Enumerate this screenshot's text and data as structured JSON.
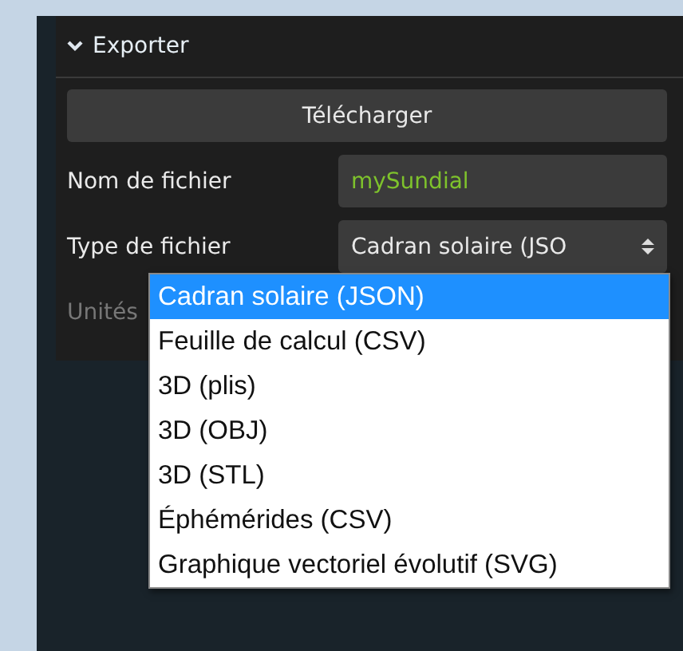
{
  "section": {
    "title": "Exporter",
    "expanded": true
  },
  "download_button": "Télécharger",
  "fields": [
    {
      "label": "Nom de fichier",
      "kind": "text",
      "value": "mySundial"
    },
    {
      "label": "Type de fichier",
      "kind": "select",
      "value": "Cadran solaire (JSO"
    },
    {
      "label": "Unités",
      "kind": "label"
    }
  ],
  "dropdown": {
    "options": [
      {
        "label": "Cadran solaire (JSON)",
        "selected": true
      },
      {
        "label": "Feuille de calcul (CSV)",
        "selected": false
      },
      {
        "label": "3D (plis)",
        "selected": false
      },
      {
        "label": "3D (OBJ)",
        "selected": false
      },
      {
        "label": "3D (STL)",
        "selected": false
      },
      {
        "label": "Éphémérides (CSV)",
        "selected": false
      },
      {
        "label": "Graphique vectoriel évolutif (SVG)",
        "selected": false
      }
    ]
  }
}
